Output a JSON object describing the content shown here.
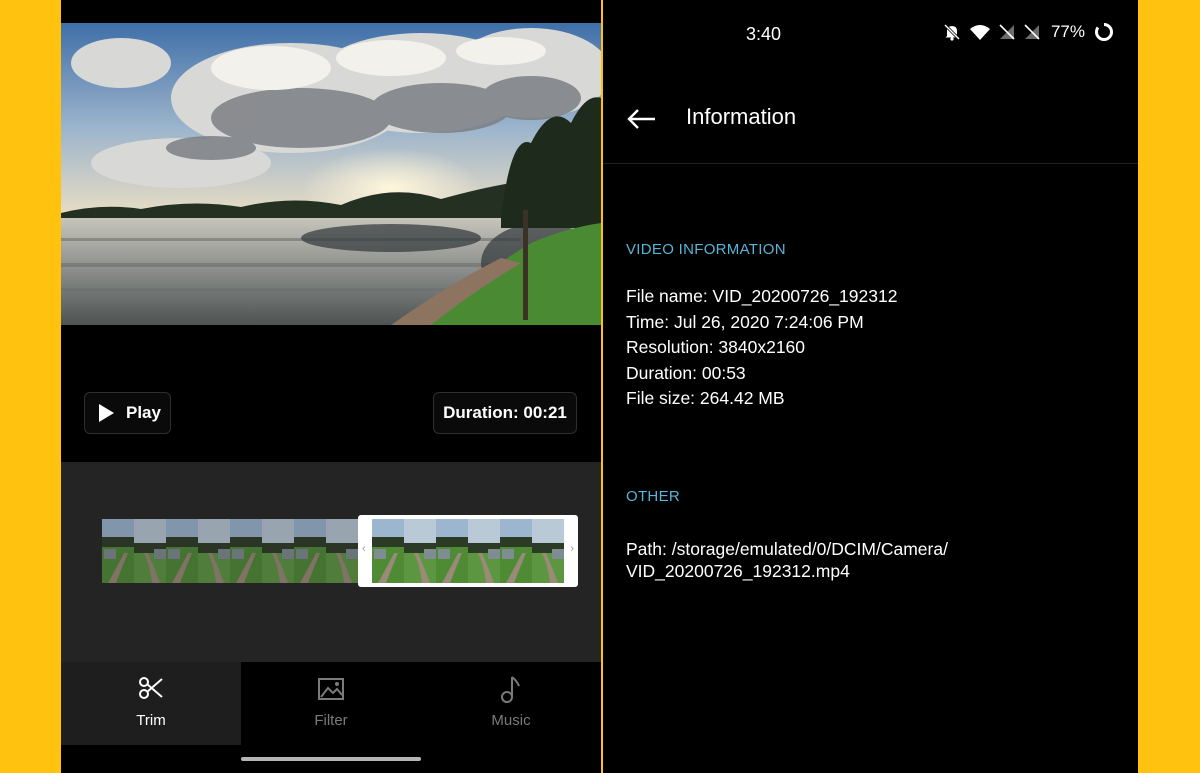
{
  "editor": {
    "play_label": "Play",
    "duration_label": "Duration: 00:21",
    "tabs": [
      {
        "label": "Trim",
        "icon": "scissors-icon",
        "active": true
      },
      {
        "label": "Filter",
        "icon": "image-sparkle-icon",
        "active": false
      },
      {
        "label": "Music",
        "icon": "music-note-icon",
        "active": false
      }
    ]
  },
  "status": {
    "time": "3:40",
    "battery": "77%",
    "icons": [
      "bell-off-icon",
      "wifi-icon",
      "no-signal-icon",
      "no-signal-icon",
      "battery-ring-icon"
    ]
  },
  "info": {
    "title": "Information",
    "video_heading": "VIDEO INFORMATION",
    "file_name": "File name: VID_20200726_192312",
    "time": "Time: Jul 26, 2020 7:24:06 PM",
    "resolution": "Resolution: 3840x2160",
    "duration": "Duration: 00:53",
    "file_size": "File size: 264.42 MB",
    "other_heading": "OTHER",
    "path_line1": "Path: /storage/emulated/0/DCIM/Camera/",
    "path_line2": "VID_20200726_192312.mp4"
  },
  "colors": {
    "frame": "#FFC20E",
    "accent": "#5AB4D8",
    "background": "#000000",
    "timeline": "#242424"
  }
}
